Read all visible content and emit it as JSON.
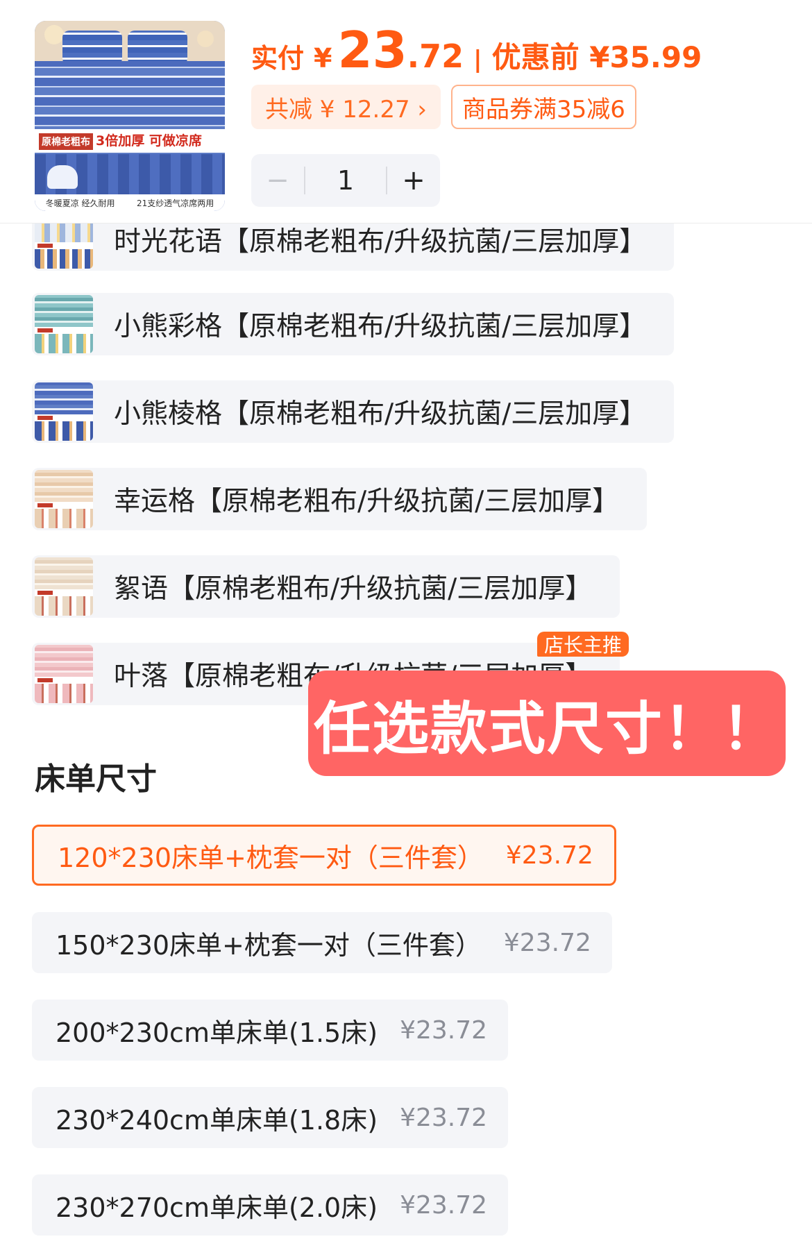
{
  "header": {
    "thumbnail_caption_left": "原棉老粗布",
    "thumbnail_caption_right": "3倍加厚 可做凉席",
    "thumbnail_footer_left": "冬暖夏凉 经久耐用",
    "thumbnail_footer_right": "21支纱透气凉席两用",
    "paid_label": "实付",
    "currency": "¥",
    "price_int": "23",
    "price_dec": ".72",
    "separator": "|",
    "original_price": "优惠前 ¥35.99",
    "discount_chip": "共减 ¥ 12.27 ›",
    "coupon_chip": "商品券满35减6",
    "quantity": {
      "minus": "−",
      "value": "1",
      "plus": "+"
    }
  },
  "styles": {
    "items": [
      {
        "label": "时光花语【原棉老粗布/升级抗菌/三层加厚】"
      },
      {
        "label": "小熊彩格【原棉老粗布/升级抗菌/三层加厚】"
      },
      {
        "label": "小熊棱格【原棉老粗布/升级抗菌/三层加厚】"
      },
      {
        "label": "幸运格【原棉老粗布/升级抗菌/三层加厚】"
      },
      {
        "label": "絮语【原棉老粗布/升级抗菌/三层加厚】"
      },
      {
        "label": "叶落【原棉老粗布/升级抗菌/三层加厚】"
      }
    ],
    "hot_badge": "店长主推"
  },
  "overlay_banner": "任选款式尺寸！！",
  "sizes": {
    "title": "床单尺寸",
    "items": [
      {
        "name": "120*230床单+枕套一对（三件套）",
        "price": "¥23.72"
      },
      {
        "name": "150*230床单+枕套一对（三件套）",
        "price": "¥23.72"
      },
      {
        "name": "200*230cm单床单(1.5床)",
        "price": "¥23.72"
      },
      {
        "name": "230*240cm单床单(1.8床)",
        "price": "¥23.72"
      },
      {
        "name": "230*270cm单床单(2.0床)",
        "price": "¥23.72"
      }
    ],
    "selected_index": 0
  },
  "colors": {
    "accent": "#ff5a12",
    "banner": "#ff6564",
    "chip_bg": "#fff0e8",
    "option_bg": "#f4f5f8"
  }
}
